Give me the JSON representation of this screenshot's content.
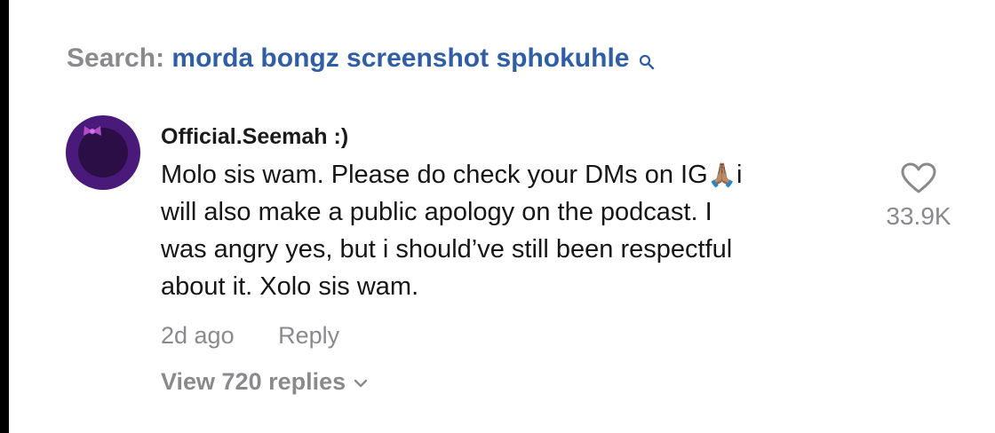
{
  "search": {
    "prefix": "Search:",
    "query": "morda bongz screenshot sphokuhle"
  },
  "comment": {
    "username": "Official.Seemah :)",
    "lines": [
      "Molo sis wam. Please do check your DMs on IG",
      "will also make a public apology on the podcast. I",
      "was angry yes, but i should’ve still been respectful",
      "about it. Xolo sis wam."
    ],
    "emoji": "🙏🏽",
    "line1_suffix": "i",
    "time": "2d ago",
    "reply_label": "Reply",
    "view_replies": "View 720 replies",
    "likes": "33.9K"
  },
  "colors": {
    "search_query": "#2f5ea6",
    "muted": "#8a8a8e",
    "avatar": "#4a1a7a"
  }
}
